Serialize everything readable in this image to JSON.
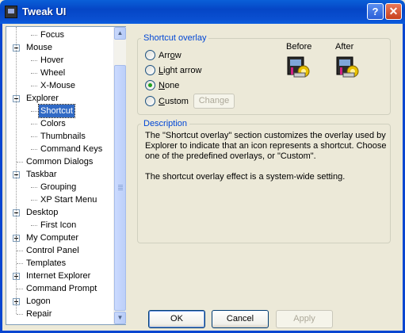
{
  "window": {
    "title": "Tweak UI"
  },
  "tree": {
    "items": [
      {
        "label": "Focus",
        "level": 2,
        "selected": false
      },
      {
        "label": "Mouse",
        "level": 1,
        "expander": "minus"
      },
      {
        "label": "Hover",
        "level": 2
      },
      {
        "label": "Wheel",
        "level": 2
      },
      {
        "label": "X-Mouse",
        "level": 2
      },
      {
        "label": "Explorer",
        "level": 1,
        "expander": "minus"
      },
      {
        "label": "Shortcut",
        "level": 2,
        "selected": true
      },
      {
        "label": "Colors",
        "level": 2
      },
      {
        "label": "Thumbnails",
        "level": 2
      },
      {
        "label": "Command Keys",
        "level": 2
      },
      {
        "label": "Common Dialogs",
        "level": 1
      },
      {
        "label": "Taskbar",
        "level": 1,
        "expander": "minus"
      },
      {
        "label": "Grouping",
        "level": 2
      },
      {
        "label": "XP Start Menu",
        "level": 2
      },
      {
        "label": "Desktop",
        "level": 1,
        "expander": "minus"
      },
      {
        "label": "First Icon",
        "level": 2
      },
      {
        "label": "My Computer",
        "level": 1,
        "expander": "plus"
      },
      {
        "label": "Control Panel",
        "level": 1
      },
      {
        "label": "Templates",
        "level": 1
      },
      {
        "label": "Internet Explorer",
        "level": 1,
        "expander": "plus"
      },
      {
        "label": "Command Prompt",
        "level": 1
      },
      {
        "label": "Logon",
        "level": 1,
        "expander": "plus"
      },
      {
        "label": "Repair",
        "level": 1
      }
    ]
  },
  "overlay": {
    "legend": "Shortcut overlay",
    "options": [
      {
        "pre": "Arr",
        "acc": "o",
        "post": "w",
        "checked": false
      },
      {
        "pre": "",
        "acc": "L",
        "post": "ight arrow",
        "checked": false
      },
      {
        "pre": "",
        "acc": "N",
        "post": "one",
        "checked": true
      },
      {
        "pre": "",
        "acc": "C",
        "post": "ustom",
        "checked": false
      }
    ],
    "change_label": "Change",
    "before_label": "Before",
    "after_label": "After"
  },
  "description": {
    "legend": "Description",
    "para1": "The \"Shortcut overlay\" section customizes the overlay used by Explorer to indicate that an icon represents a shortcut. Choose one of the predefined overlays, or \"Custom\".",
    "para2": "The shortcut overlay effect is a system-wide setting."
  },
  "buttons": {
    "ok": "OK",
    "cancel": "Cancel",
    "apply": "Apply"
  },
  "icons": {
    "app": "tweakui-app-icon",
    "help": "help-icon",
    "close": "close-icon"
  }
}
